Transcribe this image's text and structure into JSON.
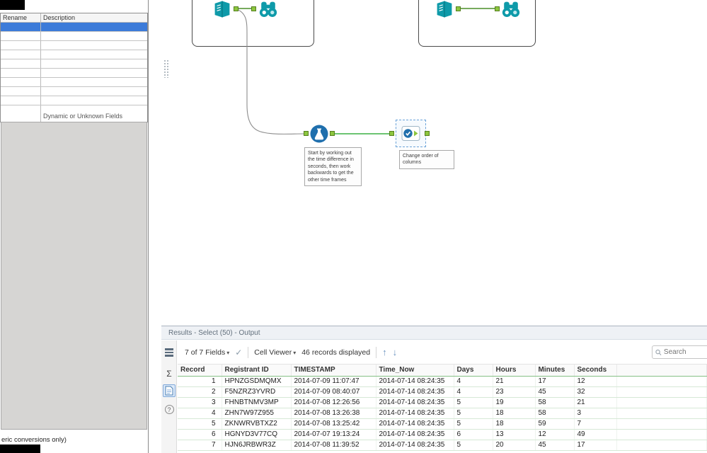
{
  "config_panel": {
    "columns": [
      "Rename",
      "Description"
    ],
    "empty_row_count": 9,
    "selected_row_index": 0,
    "dynamic_fields_label": "Dynamic or Unknown Fields",
    "footer_note": "eric conversions only)"
  },
  "canvas": {
    "tools": [
      {
        "name": "input-data",
        "container": 1
      },
      {
        "name": "browse",
        "container": 1
      },
      {
        "name": "input-data",
        "container": 2
      },
      {
        "name": "browse",
        "container": 2
      },
      {
        "name": "formula"
      },
      {
        "name": "select",
        "selected": true
      }
    ],
    "annotations": {
      "formula": "Start by working out the time difference in seconds, then work backwards to get the other time frames",
      "select": "Change order of columns"
    }
  },
  "results_panel": {
    "title": "Results - Select (50) - Output",
    "toolbar": {
      "fields_label": "7 of 7 Fields",
      "check_glyph": "✓",
      "cell_viewer_label": "Cell Viewer",
      "records_label": "46 records displayed",
      "up_arrow": "↑",
      "down_arrow": "↓",
      "search_placeholder": "Search"
    },
    "grid": {
      "columns": [
        "Record",
        "Registrant ID",
        "TIMESTAMP",
        "Time_Now",
        "Days",
        "Hours",
        "Minutes",
        "Seconds"
      ],
      "rows": [
        [
          "1",
          "HPNZGSDMQMX",
          "2014-07-09 11:07:47",
          "2014-07-14 08:24:35",
          "4",
          "21",
          "17",
          "12"
        ],
        [
          "2",
          "F5NZRZ3YVRD",
          "2014-07-09 08:40:07",
          "2014-07-14 08:24:35",
          "4",
          "23",
          "45",
          "32"
        ],
        [
          "3",
          "FHNBTNMV3MP",
          "2014-07-08 12:26:56",
          "2014-07-14 08:24:35",
          "5",
          "19",
          "58",
          "21"
        ],
        [
          "4",
          "ZHN7W97Z955",
          "2014-07-08 13:26:38",
          "2014-07-14 08:24:35",
          "5",
          "18",
          "58",
          "3"
        ],
        [
          "5",
          "ZKNWRVBTXZ2",
          "2014-07-08 13:25:42",
          "2014-07-14 08:24:35",
          "5",
          "18",
          "59",
          "7"
        ],
        [
          "6",
          "HGNYD3V77CQ",
          "2014-07-07 19:13:24",
          "2014-07-14 08:24:35",
          "6",
          "13",
          "12",
          "49"
        ],
        [
          "7",
          "HJN6JRBWR3Z",
          "2014-07-08 11:39:52",
          "2014-07-14 08:24:35",
          "5",
          "20",
          "45",
          "17"
        ]
      ]
    }
  }
}
